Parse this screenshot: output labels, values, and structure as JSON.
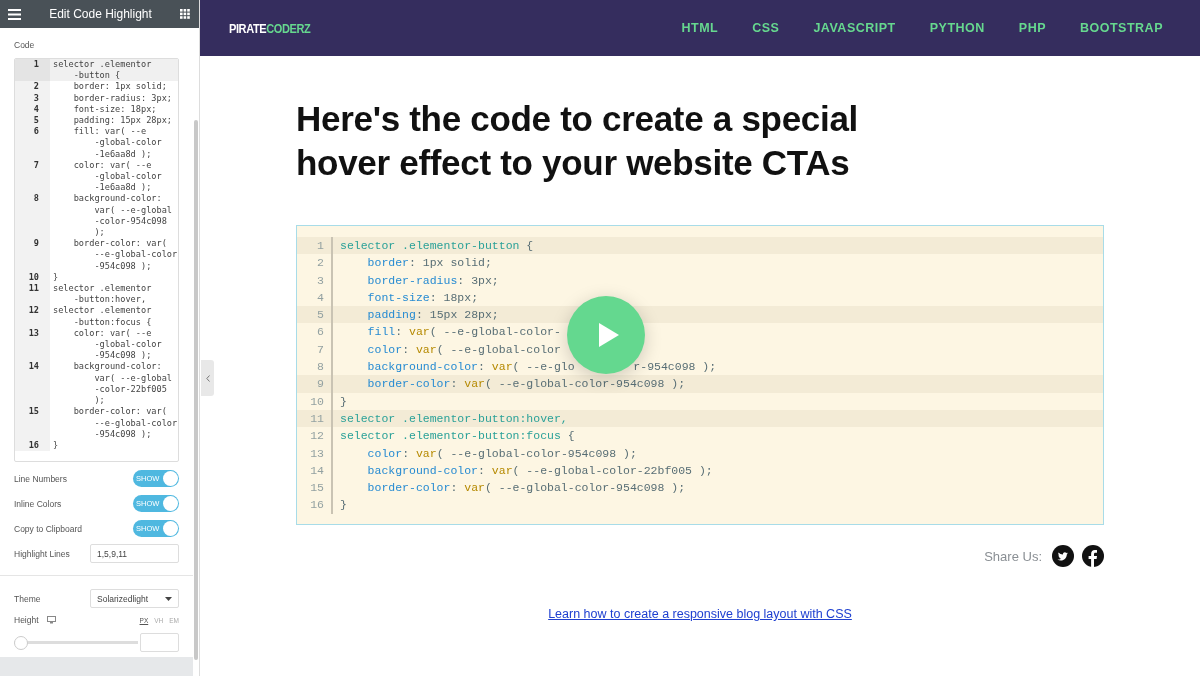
{
  "sidebar": {
    "title": "Edit Code Highlight",
    "code_label": "Code",
    "code_lines": [
      {
        "number": "1",
        "active": true,
        "rows": [
          "selector .elementor",
          "    -button {"
        ]
      },
      {
        "number": "2",
        "active": false,
        "rows": [
          "    border: 1px solid;"
        ]
      },
      {
        "number": "3",
        "active": false,
        "rows": [
          "    border-radius: 3px;"
        ]
      },
      {
        "number": "4",
        "active": false,
        "rows": [
          "    font-size: 18px;"
        ]
      },
      {
        "number": "5",
        "active": false,
        "rows": [
          "    padding: 15px 28px;"
        ]
      },
      {
        "number": "6",
        "active": false,
        "rows": [
          "    fill: var( --e",
          "        -global-color",
          "        -1e6aa8d );"
        ]
      },
      {
        "number": "7",
        "active": false,
        "rows": [
          "    color: var( --e",
          "        -global-color",
          "        -1e6aa8d );"
        ]
      },
      {
        "number": "8",
        "active": false,
        "rows": [
          "    background-color:",
          "        var( --e-global",
          "        -color-954c098",
          "        );"
        ]
      },
      {
        "number": "9",
        "active": false,
        "rows": [
          "    border-color: var(",
          "        --e-global-color",
          "        -954c098 );"
        ]
      },
      {
        "number": "10",
        "active": false,
        "rows": [
          "}"
        ]
      },
      {
        "number": "11",
        "active": false,
        "rows": [
          "selector .elementor",
          "    -button:hover,"
        ]
      },
      {
        "number": "12",
        "active": false,
        "rows": [
          "selector .elementor",
          "    -button:focus {"
        ]
      },
      {
        "number": "13",
        "active": false,
        "rows": [
          "    color: var( --e",
          "        -global-color",
          "        -954c098 );"
        ]
      },
      {
        "number": "14",
        "active": false,
        "rows": [
          "    background-color:",
          "        var( --e-global",
          "        -color-22bf005",
          "        );"
        ]
      },
      {
        "number": "15",
        "active": false,
        "rows": [
          "    border-color: var(",
          "        --e-global-color",
          "        -954c098 );"
        ]
      },
      {
        "number": "16",
        "active": false,
        "rows": [
          "}"
        ]
      }
    ],
    "toggles": [
      {
        "label": "Line Numbers",
        "state_text": "SHOW",
        "on": true
      },
      {
        "label": "Inline Colors",
        "state_text": "SHOW",
        "on": true
      },
      {
        "label": "Copy to Clipboard",
        "state_text": "SHOW",
        "on": true
      }
    ],
    "highlight_lines": {
      "label": "Highlight Lines",
      "value": "1,5,9,11"
    },
    "theme": {
      "label": "Theme",
      "value": "Solarizedlight"
    },
    "height": {
      "label": "Height",
      "units": [
        {
          "label": "PX",
          "selected": true
        },
        {
          "label": "VH",
          "selected": false
        },
        {
          "label": "EM",
          "selected": false
        }
      ],
      "level": 0
    }
  },
  "navbar": {
    "logo": {
      "first": "PIRATE",
      "second": "CODERZ"
    },
    "links": [
      "HTML",
      "CSS",
      "JAVASCRIPT",
      "PYTHON",
      "PHP",
      "BOOTSTRAP"
    ]
  },
  "article": {
    "heading": "Here's the code to create a special hover effect to your website CTAs",
    "code_lines": [
      {
        "number": "1",
        "highlighted": true,
        "tokens": [
          {
            "kind": "selector",
            "text": "selector .elementor-button"
          },
          {
            "kind": "plain",
            "text": " {"
          }
        ]
      },
      {
        "number": "2",
        "highlighted": false,
        "tokens": [
          {
            "kind": "property",
            "text": "    border"
          },
          {
            "kind": "plain",
            "text": ": 1px solid;"
          }
        ]
      },
      {
        "number": "3",
        "highlighted": false,
        "tokens": [
          {
            "kind": "property",
            "text": "    border-radius"
          },
          {
            "kind": "plain",
            "text": ": 3px;"
          }
        ]
      },
      {
        "number": "4",
        "highlighted": false,
        "tokens": [
          {
            "kind": "property",
            "text": "    font-size"
          },
          {
            "kind": "plain",
            "text": ": 18px;"
          }
        ]
      },
      {
        "number": "5",
        "highlighted": true,
        "tokens": [
          {
            "kind": "property",
            "text": "    padding"
          },
          {
            "kind": "plain",
            "text": ": 15px 28px;"
          }
        ]
      },
      {
        "number": "6",
        "highlighted": false,
        "tokens": [
          {
            "kind": "property",
            "text": "    fill"
          },
          {
            "kind": "plain",
            "text": ": "
          },
          {
            "kind": "function",
            "text": "var"
          },
          {
            "kind": "plain",
            "text": "( --e-global-color-"
          }
        ]
      },
      {
        "number": "7",
        "highlighted": false,
        "tokens": [
          {
            "kind": "property",
            "text": "    color"
          },
          {
            "kind": "plain",
            "text": ": "
          },
          {
            "kind": "function",
            "text": "var"
          },
          {
            "kind": "plain",
            "text": "( --e-global-color"
          }
        ]
      },
      {
        "number": "8",
        "highlighted": false,
        "tokens": [
          {
            "kind": "property",
            "text": "    background-color"
          },
          {
            "kind": "plain",
            "text": ": "
          },
          {
            "kind": "function",
            "text": "var"
          },
          {
            "kind": "plain",
            "text": "( --e-glo"
          },
          {
            "kind": "gap"
          },
          {
            "kind": "plain",
            "text": "r-954c098 );"
          }
        ]
      },
      {
        "number": "9",
        "highlighted": true,
        "tokens": [
          {
            "kind": "property",
            "text": "    border-color"
          },
          {
            "kind": "plain",
            "text": ": "
          },
          {
            "kind": "function",
            "text": "var"
          },
          {
            "kind": "plain",
            "text": "( --e-global-color-954c098 );"
          }
        ]
      },
      {
        "number": "10",
        "highlighted": false,
        "tokens": [
          {
            "kind": "plain",
            "text": "}"
          }
        ]
      },
      {
        "number": "11",
        "highlighted": true,
        "tokens": [
          {
            "kind": "selector",
            "text": "selector .elementor-button:hover,"
          }
        ]
      },
      {
        "number": "12",
        "highlighted": false,
        "tokens": [
          {
            "kind": "selector",
            "text": "selector .elementor-button:focus"
          },
          {
            "kind": "plain",
            "text": " {"
          }
        ]
      },
      {
        "number": "13",
        "highlighted": false,
        "tokens": [
          {
            "kind": "property",
            "text": "    color"
          },
          {
            "kind": "plain",
            "text": ": "
          },
          {
            "kind": "function",
            "text": "var"
          },
          {
            "kind": "plain",
            "text": "( --e-global-color-954c098 );"
          }
        ]
      },
      {
        "number": "14",
        "highlighted": false,
        "tokens": [
          {
            "kind": "property",
            "text": "    background-color"
          },
          {
            "kind": "plain",
            "text": ": "
          },
          {
            "kind": "function",
            "text": "var"
          },
          {
            "kind": "plain",
            "text": "( --e-global-color-22bf005 );"
          }
        ]
      },
      {
        "number": "15",
        "highlighted": false,
        "tokens": [
          {
            "kind": "property",
            "text": "    border-color"
          },
          {
            "kind": "plain",
            "text": ": "
          },
          {
            "kind": "function",
            "text": "var"
          },
          {
            "kind": "plain",
            "text": "( --e-global-color-954c098 );"
          }
        ]
      },
      {
        "number": "16",
        "highlighted": false,
        "tokens": [
          {
            "kind": "plain",
            "text": "}"
          }
        ]
      }
    ],
    "share_label": "Share Us:",
    "link": "Learn how to create a responsive blog layout with CSS"
  }
}
